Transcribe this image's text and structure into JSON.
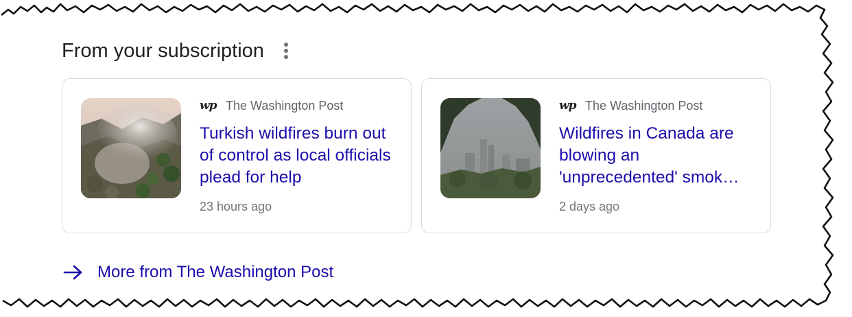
{
  "section": {
    "title": "From your subscription",
    "menu_icon": "more-vert-icon"
  },
  "cards": [
    {
      "source_logo": "wp",
      "source_name": "The Washington Post",
      "headline": "Turkish wildfires burn out of control as local officials plead for help",
      "time": "23 hours ago",
      "image": "wildfire-hillside-smoke"
    },
    {
      "source_logo": "wp",
      "source_name": "The Washington Post",
      "headline": "Wildfires in Canada are blowing an 'unprecedented' smok…",
      "time": "2 days ago",
      "image": "hazy-city-skyline"
    }
  ],
  "more_link": {
    "label": "More from The Washington Post",
    "icon": "arrow-right-icon"
  },
  "colors": {
    "link": "#1a0dab",
    "title": "#202124",
    "secondary": "#5f6368",
    "border": "#dadce0"
  }
}
